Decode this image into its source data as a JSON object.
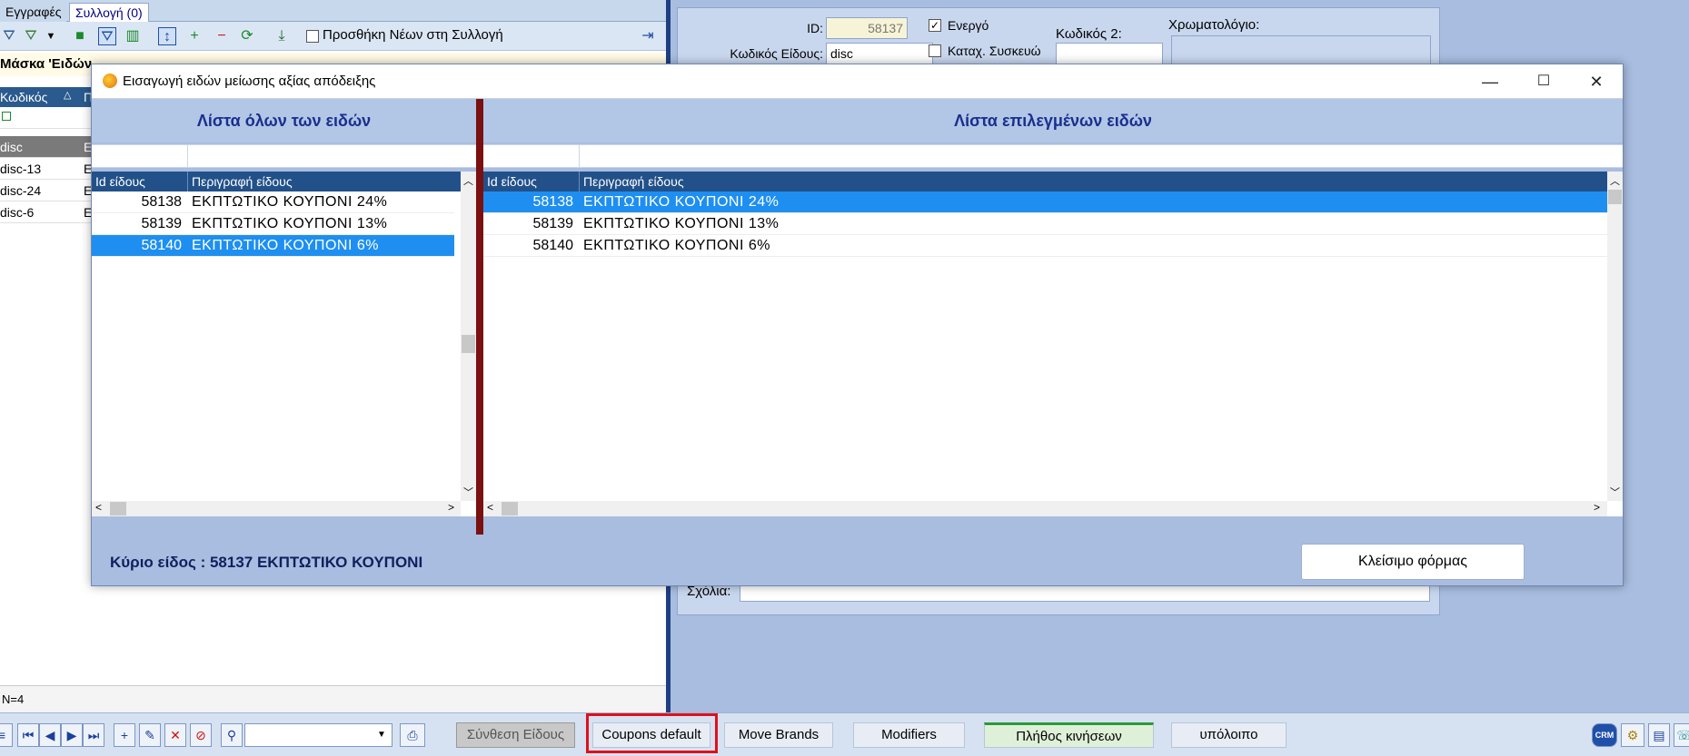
{
  "left": {
    "tabs": [
      "Εγγραφές",
      "Συλλογή (0)"
    ],
    "add_new_label": "Προσθήκη Νέων στη Συλλογή",
    "mask_label": "Μάσκα 'Ειδών",
    "grid_headers": [
      "Κωδικός",
      "Π"
    ],
    "rows": [
      {
        "code": "disc",
        "desc": "Ε"
      },
      {
        "code": "disc-13",
        "desc": "Ε"
      },
      {
        "code": "disc-24",
        "desc": "Ε"
      },
      {
        "code": "disc-6",
        "desc": "Ε"
      }
    ],
    "status_count": "N=4"
  },
  "form": {
    "id_label": "ID:",
    "id_value": "58137",
    "code_label": "Κωδικός Είδους:",
    "code_value": "disc",
    "active_label": "Ενεργό",
    "device_label": "Καταχ. Συσκευώ",
    "code2_label": "Κωδικός 2:",
    "color_label": "Χρωματολόγιο:",
    "notes_label": "Σχόλια:"
  },
  "modal": {
    "title": "Εισαγωγή ειδών μείωσης αξίας απόδειξης",
    "left_pane_title": "Λίστα όλων των ειδών",
    "right_pane_title": "Λίστα επιλεγμένων ειδών",
    "col_id": "Id είδους",
    "col_desc": "Περιγραφή είδους",
    "all_items": [
      {
        "id": "58138",
        "desc": "ΕΚΠΤΩΤΙΚΟ ΚΟΥΠΟΝΙ 24%",
        "selected": false
      },
      {
        "id": "58139",
        "desc": "ΕΚΠΤΩΤΙΚΟ ΚΟΥΠΟΝΙ 13%",
        "selected": false
      },
      {
        "id": "58140",
        "desc": "ΕΚΠΤΩΤΙΚΟ ΚΟΥΠΟΝΙ 6%",
        "selected": true
      }
    ],
    "selected_items": [
      {
        "id": "58138",
        "desc": "ΕΚΠΤΩΤΙΚΟ ΚΟΥΠΟΝΙ 24%",
        "selected": true
      },
      {
        "id": "58139",
        "desc": "ΕΚΠΤΩΤΙΚΟ ΚΟΥΠΟΝΙ 13%",
        "selected": false
      },
      {
        "id": "58140",
        "desc": "ΕΚΠΤΩΤΙΚΟ ΚΟΥΠΟΝΙ 6%",
        "selected": false
      }
    ],
    "main_item_label": "Κύριο είδος : 58137   ΕΚΠΤΩΤΙΚΟ ΚΟΥΠΟΝΙ",
    "close_button": "Κλείσιμο φόρμας"
  },
  "bottom": {
    "compose_button": "Σύνθεση Είδους",
    "coupons_button": "Coupons default",
    "move_brands_button": "Move Brands",
    "modifiers_button": "Modifiers",
    "movements_button": "Πλήθος κινήσεων",
    "balance_button": "υπόλοιπο",
    "crm_label": "CRM"
  },
  "colors": {
    "selection": "#1e8ff0",
    "grid_header": "#22518a",
    "highlight_border": "#e0101a",
    "pane_title": "#1a2f8e"
  }
}
